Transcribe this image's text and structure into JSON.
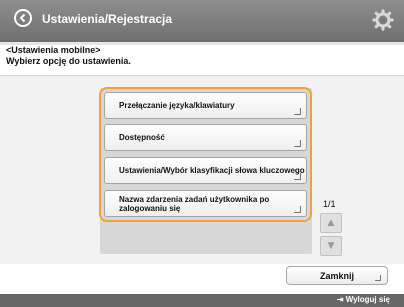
{
  "header": {
    "title": "Ustawienia/Rejestracja"
  },
  "info": {
    "line1": "<Ustawienia mobilne>",
    "line2": "Wybierz opcję do ustawienia."
  },
  "items": [
    {
      "label": "Przełączanie języka/klawiatury"
    },
    {
      "label": "Dostępność"
    },
    {
      "label": "Ustawienia/Wybór klasyfikacji słowa kluczowego"
    },
    {
      "label": "Nazwa zdarzenia zadań użytkownika po zalogowaniu się"
    }
  ],
  "pagination": {
    "indicator": "1/1"
  },
  "buttons": {
    "close_label": "Zamknij"
  },
  "footer": {
    "logout_label": "Wyloguj się"
  },
  "colors": {
    "highlight": "#f0a23a",
    "header": "#7f7f7f"
  }
}
